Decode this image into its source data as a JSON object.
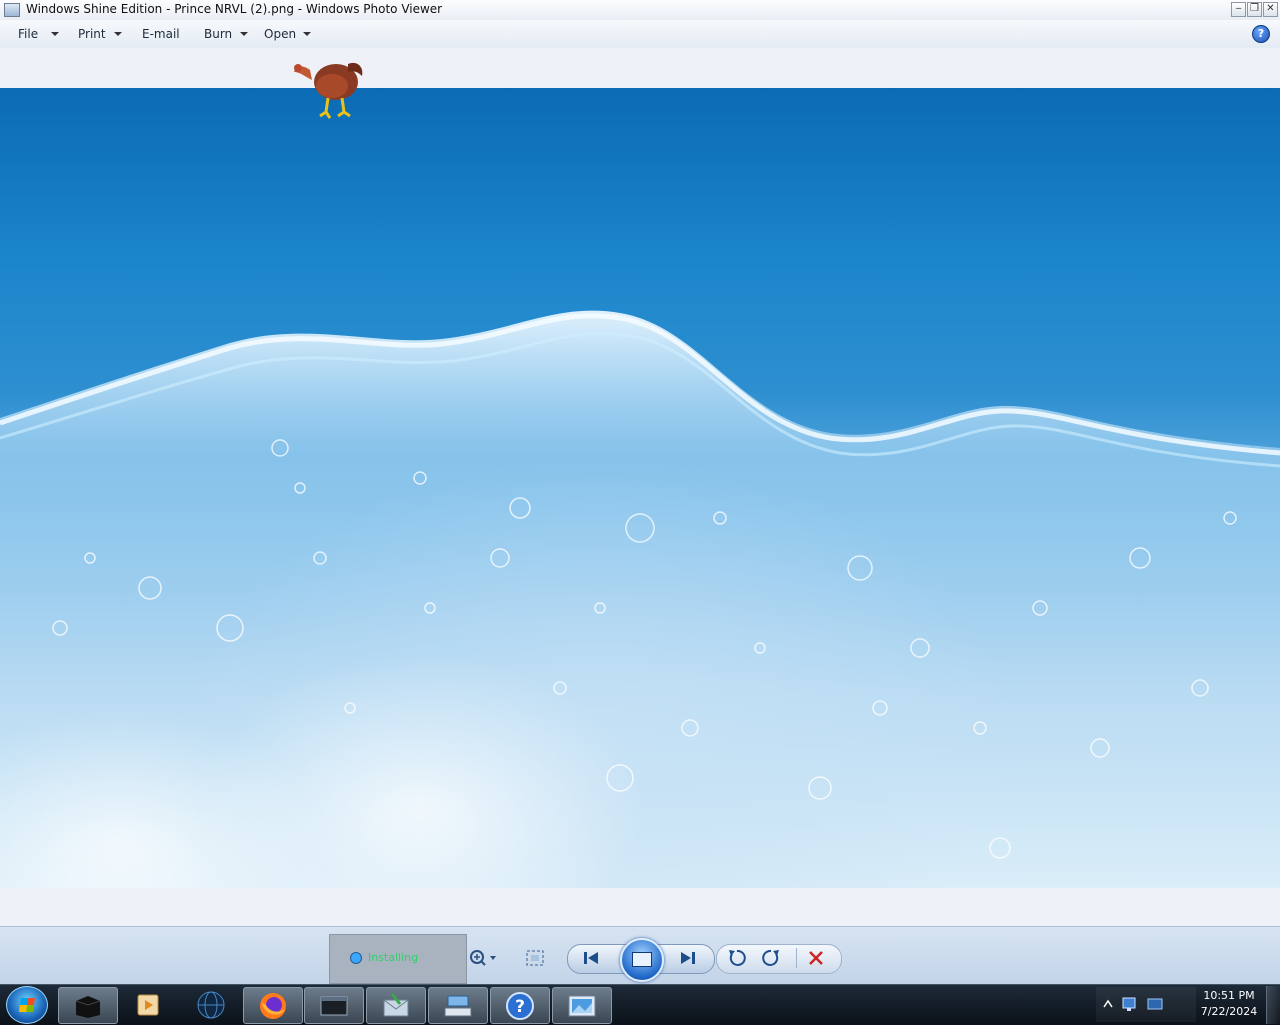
{
  "window": {
    "title": "Windows Shine Edition - Prince NRVL (2).png - Windows Photo Viewer",
    "buttons": [
      "minimize",
      "restore",
      "close"
    ]
  },
  "menubar": {
    "items": [
      {
        "label": "File",
        "has_dropdown": true
      },
      {
        "label": "Print",
        "has_dropdown": true
      },
      {
        "label": "E-mail",
        "has_dropdown": false
      },
      {
        "label": "Burn",
        "has_dropdown": true
      },
      {
        "label": "Open",
        "has_dropdown": true
      }
    ],
    "help_label": "?"
  },
  "status_tooltip": {
    "text": "Installing"
  },
  "controls": {
    "icons": [
      "zoom-icon",
      "actual-size-icon",
      "previous-icon",
      "slideshow-icon",
      "next-icon",
      "rotate-counterclockwise-icon",
      "rotate-clockwise-icon",
      "delete-icon"
    ]
  },
  "taskbar": {
    "clock_time": "10:51 PM",
    "clock_date": "7/22/2024",
    "items": [
      "black-box-app",
      "media-player",
      "dark-orb-app",
      "firefox",
      "terminal-window",
      "mail-app",
      "keyboard-app",
      "help-app",
      "photo-viewer"
    ]
  },
  "colors": {
    "accent": "#1a64b8",
    "close": "#cc2222",
    "status_text": "#2fd16a"
  }
}
